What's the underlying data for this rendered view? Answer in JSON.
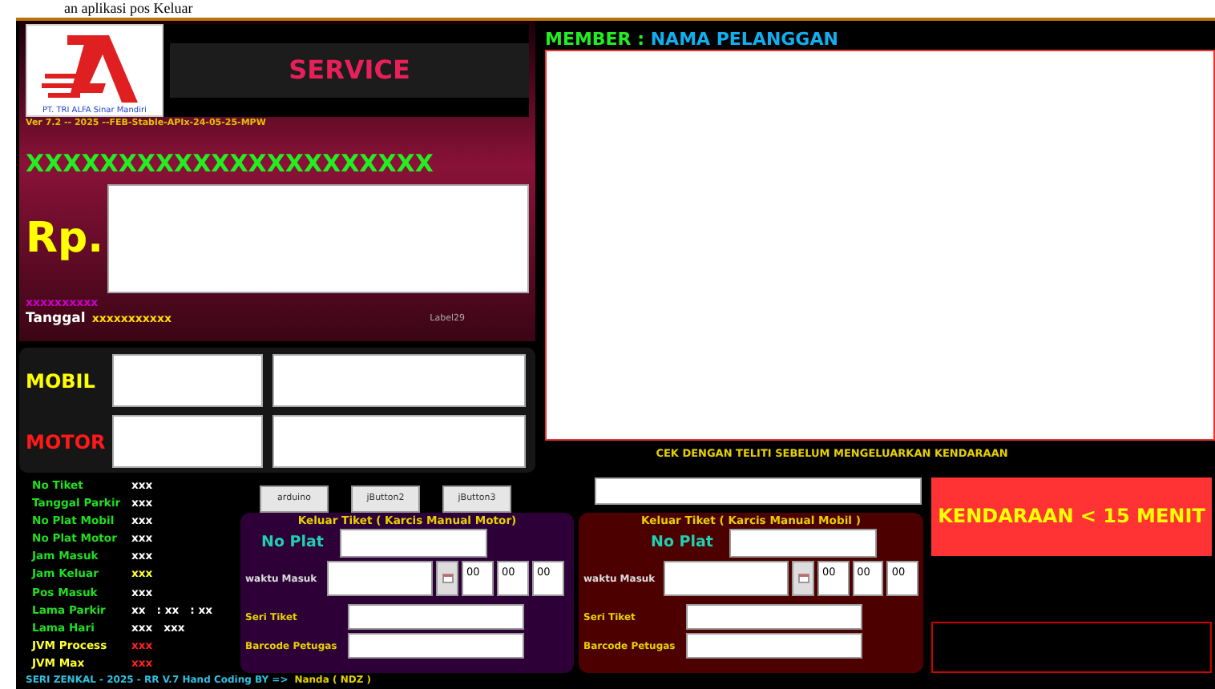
{
  "caption": "an aplikasi pos Keluar",
  "header": {
    "logo_text": "PT. TRI ALFA Sinar Mandiri",
    "service": "SERVICE",
    "version": "Ver 7.2 -- 2025 --FEB-Stable-APIx-24-05-25-MPW",
    "code": "XXXXXXXXXXXXXXXXXXXXXX"
  },
  "amount": {
    "label": "Rp."
  },
  "purple_text": "xxxxxxxxxx",
  "date": {
    "label": "Tanggal",
    "value": "xxxxxxxxxxx",
    "note": "Label29"
  },
  "vehicles": [
    {
      "label": "MOBIL",
      "color": "#ffff00"
    },
    {
      "label": "MOTOR",
      "color": "#ff1a1a"
    }
  ],
  "member": {
    "label": "MEMBER :",
    "name": "NAMA PELANGGAN"
  },
  "notice": "CEK DENGAN TELITI SEBELUM MENGELUARKAN KENDARAAN",
  "info": [
    {
      "label": "No Tiket",
      "color": "#22dd22",
      "values": [
        {
          "text": "xxx",
          "color": "#ffffff"
        }
      ]
    },
    {
      "label": "Tanggal Parkir",
      "color": "#22dd22",
      "values": [
        {
          "text": "xxx",
          "color": "#ffffff"
        }
      ]
    },
    {
      "label": "No Plat Mobil",
      "color": "#22dd22",
      "values": [
        {
          "text": "xxx",
          "color": "#ffffff"
        }
      ]
    },
    {
      "label": "No Plat Motor",
      "color": "#22dd22",
      "values": [
        {
          "text": "xxx",
          "color": "#ffffff"
        }
      ]
    },
    {
      "label": "Jam Masuk",
      "color": "#22dd22",
      "values": [
        {
          "text": "xxx",
          "color": "#ffffff"
        }
      ]
    },
    {
      "label": "Jam Keluar",
      "color": "#22dd22",
      "values": [
        {
          "text": "xxx",
          "color": "#ffff33"
        }
      ]
    },
    {
      "label": "Pos Masuk",
      "color": "#22dd22",
      "values": [
        {
          "text": "xxx",
          "color": "#ffffff"
        }
      ]
    },
    {
      "label": "Lama Parkir",
      "color": "#22dd22",
      "values": [
        {
          "text": "xx",
          "color": "#ffffff"
        },
        {
          "text": ": xx",
          "color": "#ffffff"
        },
        {
          "text": ": xx",
          "color": "#ffffff"
        }
      ]
    },
    {
      "label": "Lama Hari",
      "color": "#22dd22",
      "values": [
        {
          "text": "xxx",
          "color": "#ffffff"
        },
        {
          "text": "xxx",
          "color": "#ffffff"
        }
      ]
    },
    {
      "label": "JVM Process",
      "color": "#ffff33",
      "values": [
        {
          "text": "xxx",
          "color": "#ff2222"
        }
      ]
    },
    {
      "label": "JVM Max",
      "color": "#ffff33",
      "values": [
        {
          "text": "xxx",
          "color": "#ff2222"
        }
      ]
    }
  ],
  "buttons": [
    "arduino",
    "jButton2",
    "jButton3"
  ],
  "panels": [
    {
      "title": "Keluar Tiket ( Karcis Manual Motor)",
      "color": "#2d0038",
      "plat_label": "No Plat",
      "time_label": "waktu Masuk",
      "times": [
        "00",
        "00",
        "00"
      ],
      "seri_label": "Seri Tiket",
      "barcode_label": "Barcode Petugas"
    },
    {
      "title": "Keluar Tiket ( Karcis Manual Mobil )",
      "color": "#4d0000",
      "plat_label": "No Plat",
      "time_label": "waktu Masuk",
      "times": [
        "00",
        "00",
        "00"
      ],
      "seri_label": "Seri Tiket",
      "barcode_label": "Barcode Petugas"
    }
  ],
  "alert": "KENDARAAN < 15 MENIT",
  "footer": {
    "text": "SERI ZENKAL - 2025 - RR V.7  Hand Coding BY =>",
    "author": "Nanda ( NDZ )"
  }
}
